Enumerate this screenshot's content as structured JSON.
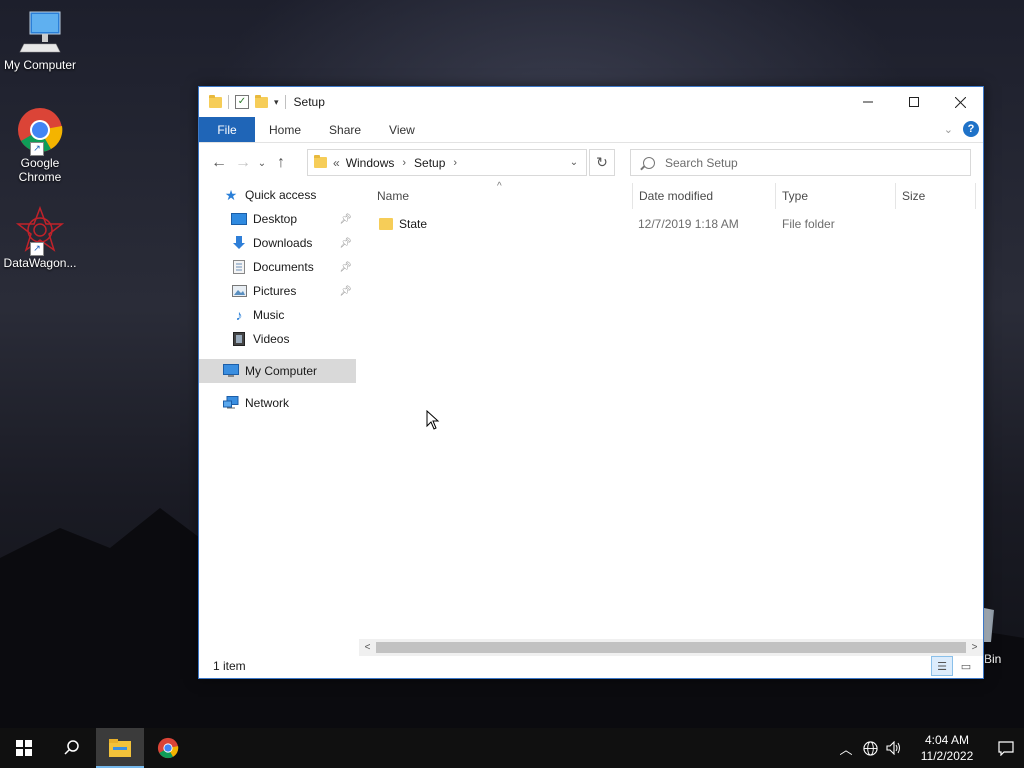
{
  "desktop": {
    "icons": [
      {
        "label": "My Computer",
        "icon": "computer-icon"
      },
      {
        "label": "Google Chrome",
        "icon": "chrome-icon"
      },
      {
        "label": "DataWagon...",
        "icon": "datawagon-icon"
      }
    ],
    "recycle_bin_partial_label": "Bin"
  },
  "window": {
    "title": "Setup",
    "ribbon_tabs": [
      "File",
      "Home",
      "Share",
      "View"
    ],
    "address": {
      "overflow": "«",
      "crumbs": [
        "Windows",
        "Setup"
      ]
    },
    "search": {
      "placeholder": "Search Setup"
    },
    "sidebar": {
      "quick_access": "Quick access",
      "items": [
        {
          "label": "Desktop",
          "icon": "desktop-folder-icon",
          "pinned": true
        },
        {
          "label": "Downloads",
          "icon": "download-arrow-icon",
          "pinned": true
        },
        {
          "label": "Documents",
          "icon": "document-icon",
          "pinned": true
        },
        {
          "label": "Pictures",
          "icon": "picture-icon",
          "pinned": true
        },
        {
          "label": "Music",
          "icon": "music-note-icon",
          "pinned": false
        },
        {
          "label": "Videos",
          "icon": "film-icon",
          "pinned": false
        }
      ],
      "my_computer": "My Computer",
      "network": "Network"
    },
    "columns": [
      "Name",
      "Date modified",
      "Type",
      "Size"
    ],
    "rows": [
      {
        "name": "State",
        "date_modified": "12/7/2019 1:18 AM",
        "type": "File folder",
        "size": ""
      }
    ],
    "status": "1 item"
  },
  "taskbar": {
    "time": "4:04 AM",
    "date": "11/2/2022"
  },
  "colors": {
    "accent": "#1f65b7",
    "folder": "#f6cd58",
    "taskbar": "#101010",
    "selection": "#d9d9d9"
  }
}
